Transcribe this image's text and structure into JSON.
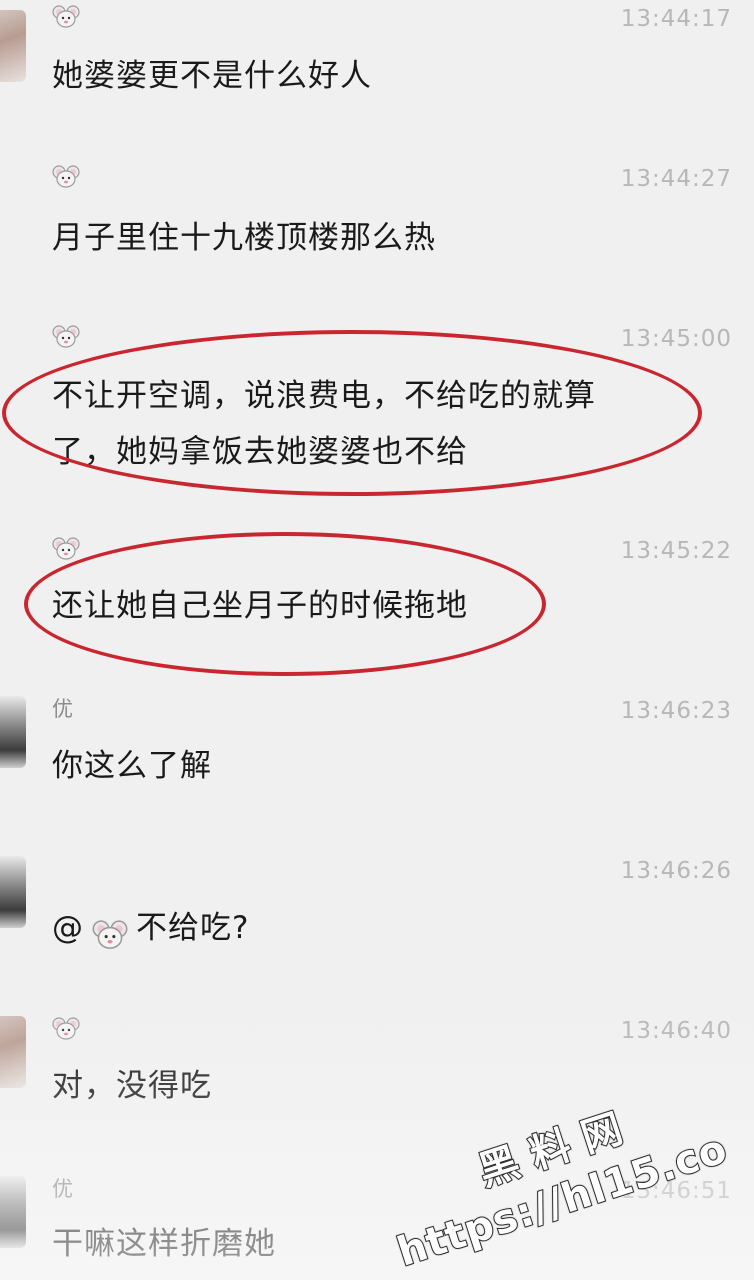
{
  "messages": [
    {
      "sender": "",
      "sender_icon": "mouse-emoji-icon",
      "time": "13:44:17",
      "lines": [
        "她婆婆更不是什么好人"
      ],
      "avatar": "woman"
    },
    {
      "sender": "",
      "sender_icon": "mouse-emoji-icon",
      "time": "13:44:27",
      "lines": [
        "月子里住十九楼顶楼那么热"
      ]
    },
    {
      "sender": "",
      "sender_icon": "mouse-emoji-icon",
      "time": "13:45:00",
      "lines": [
        "不让开空调，说浪费电，不给吃的就算",
        "了，她妈拿饭去她婆婆也不给"
      ],
      "highlighted": true
    },
    {
      "sender": "",
      "sender_icon": "mouse-emoji-icon",
      "time": "13:45:22",
      "lines": [
        "还让她自己坐月子的时候拖地"
      ],
      "highlighted": true
    },
    {
      "sender": "优",
      "time": "13:46:23",
      "lines": [
        "你这么了解"
      ],
      "avatar": "man"
    },
    {
      "sender": "",
      "time": "13:46:26",
      "mention_prefix": "@",
      "mention_icon": "mouse-emoji-icon",
      "lines": [
        "不给吃?"
      ],
      "avatar": "man"
    },
    {
      "sender": "",
      "sender_icon": "mouse-emoji-icon",
      "time": "13:46:40",
      "lines": [
        "对，没得吃"
      ],
      "avatar": "woman"
    },
    {
      "sender": "优",
      "time": "13:46:51",
      "lines": [
        "干嘛这样折磨她"
      ],
      "avatar": "man"
    }
  ],
  "watermark": {
    "title": "黑料网",
    "url": "https://hl15.co"
  },
  "colors": {
    "highlight": "#c9272f",
    "time": "#b7b7b7",
    "background": "#f0f0f0"
  }
}
